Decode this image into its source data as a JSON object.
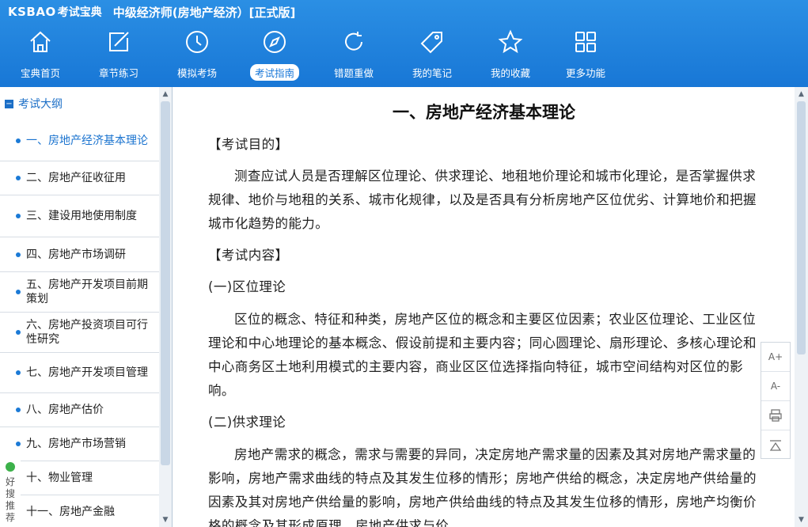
{
  "header": {
    "logo": "KSBAO",
    "logo_cn": "考试宝典",
    "app_title": "中级经济师(房地产经济）[正式版]"
  },
  "nav": [
    {
      "label": "宝典首页",
      "icon": "home-icon"
    },
    {
      "label": "章节练习",
      "icon": "edit-icon"
    },
    {
      "label": "模拟考场",
      "icon": "clock-icon"
    },
    {
      "label": "考试指南",
      "icon": "compass-icon"
    },
    {
      "label": "错题重做",
      "icon": "refresh-icon"
    },
    {
      "label": "我的笔记",
      "icon": "tag-icon"
    },
    {
      "label": "我的收藏",
      "icon": "star-icon"
    },
    {
      "label": "更多功能",
      "icon": "grid-icon"
    }
  ],
  "sidebar": {
    "heading": "考试大纲",
    "items": [
      {
        "label": "一、房地产经济基本理论"
      },
      {
        "label": "二、房地产征收征用"
      },
      {
        "label": "三、建设用地使用制度"
      },
      {
        "label": "四、房地产市场调研"
      },
      {
        "label": "五、房地产开发项目前期策划"
      },
      {
        "label": "六、房地产投资项目可行性研究"
      },
      {
        "label": "七、房地产开发项目管理"
      },
      {
        "label": "八、房地产估价"
      },
      {
        "label": "九、房地产市场营销"
      },
      {
        "label": "十、物业管理"
      },
      {
        "label": "十一、房地产金融"
      }
    ],
    "haosou": [
      "好",
      "搜",
      "推",
      "荐"
    ]
  },
  "content": {
    "title": "一、房地产经济基本理论",
    "purpose_heading": "【考试目的】",
    "purpose_text": "测查应试人员是否理解区位理论、供求理论、地租地价理论和城市化理论，是否掌握供求规律、地价与地租的关系、城市化规律，以及是否具有分析房地产区位优劣、计算地价和把握城市化趋势的能力。",
    "content_heading": "【考试内容】",
    "section1_heading": "(一)区位理论",
    "section1_text": "区位的概念、特征和种类，房地产区位的概念和主要区位因素；农业区位理论、工业区位理论和中心地理论的基本概念、假设前提和主要内容；同心圆理论、扇形理论、多核心理论和中心商务区土地利用模式的主要内容，商业区区位选择指向特征，城市空间结构对区位的影响。",
    "section2_heading": "(二)供求理论",
    "section2_text": "房地产需求的概念，需求与需要的异同，决定房地产需求量的因素及其对房地产需求量的影响，房地产需求曲线的特点及其发生位移的情形；房地产供给的概念，决定房地产供给量的因素及其对房地产供给量的影响，房地产供给曲线的特点及其发生位移的情形，房地产均衡价格的概念及其形成原理，房地产供求与价"
  },
  "tools": [
    "A+",
    "A-",
    "print-icon",
    "back-to-top-icon"
  ],
  "colors": {
    "header": "#1f84de",
    "accent": "#1a73cf"
  }
}
